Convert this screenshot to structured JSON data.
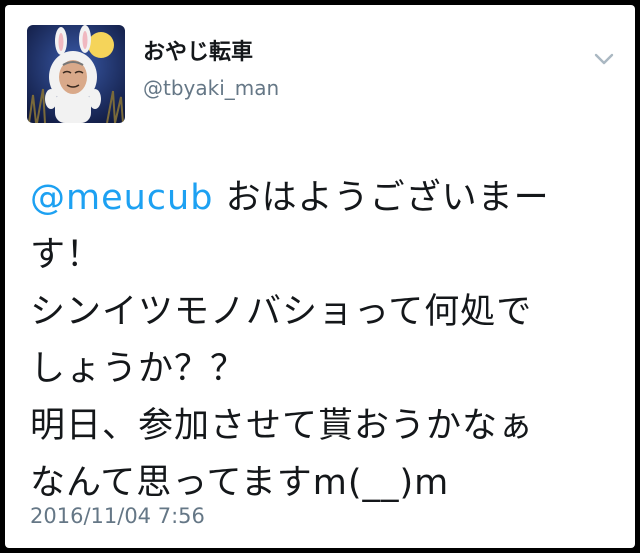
{
  "user": {
    "display_name": "おやじ転車",
    "handle": "@tbyaki_man"
  },
  "tweet": {
    "mention": "@meucub",
    "line1_rest": " おはようございまー",
    "line2": "す！",
    "line3": "シンイツモノバショって何処で",
    "line4": "しょうか？？",
    "line5": "明日、参加させて貰おうかなぁ",
    "line6": "なんて思ってますm(__)m"
  },
  "timestamp": "2016/11/04 7:56",
  "icons": {
    "menu": "chevron-down-icon",
    "avatar": "avatar"
  },
  "colors": {
    "link": "#1da1f2",
    "secondary_text": "#657786",
    "primary_text": "#14171a",
    "avatar_sky": "#1a2a5e"
  }
}
